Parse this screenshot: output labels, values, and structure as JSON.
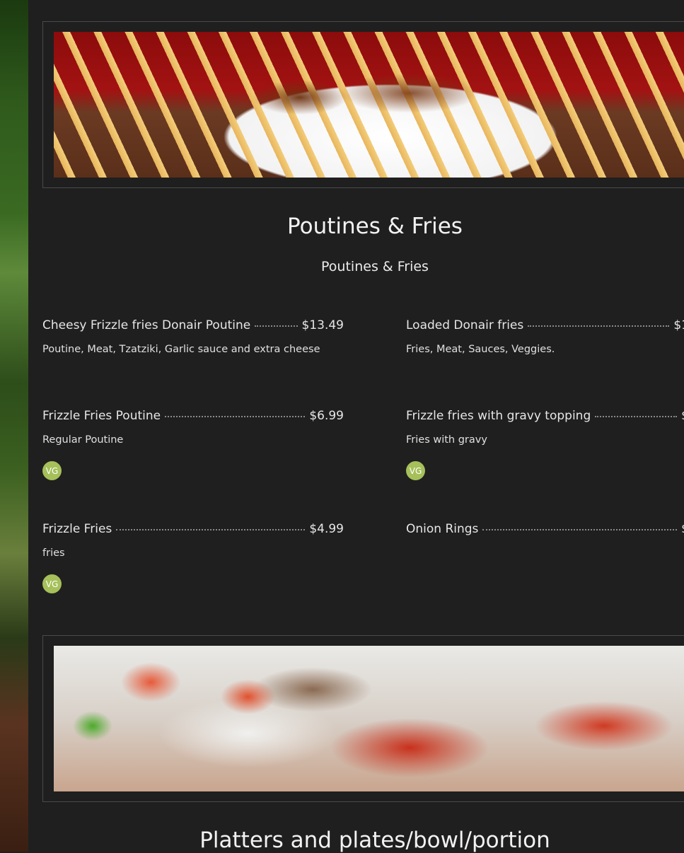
{
  "section": {
    "title": "Poutines & Fries",
    "subtitle": "Poutines & Fries"
  },
  "images": {
    "top_banner": "poutine-photo",
    "bottom_banner": "donair-platter-photo"
  },
  "items": [
    {
      "name": "Cheesy Frizzle fries Donair Poutine",
      "price": "$13.49",
      "description": "Poutine, Meat, Tzatziki, Garlic sauce and extra cheese",
      "badge": ""
    },
    {
      "name": "Loaded Donair fries",
      "price": "$1",
      "description": "Fries, Meat, Sauces, Veggies.",
      "badge": ""
    },
    {
      "name": "Frizzle Fries Poutine",
      "price": "$6.99",
      "description": "Regular Poutine",
      "badge": "VG"
    },
    {
      "name": "Frizzle fries with gravy topping",
      "price": "$",
      "description": "Fries with gravy",
      "badge": "VG"
    },
    {
      "name": "Frizzle Fries",
      "price": "$4.99",
      "description": "fries",
      "badge": "VG"
    },
    {
      "name": "Onion Rings",
      "price": "$",
      "description": "",
      "badge": ""
    }
  ],
  "next_section": {
    "title": "Platters and plates/bowl/portion"
  },
  "colors": {
    "background": "#1f1f1f",
    "badge": "#a6c05a",
    "text": "#e8e8e8"
  }
}
